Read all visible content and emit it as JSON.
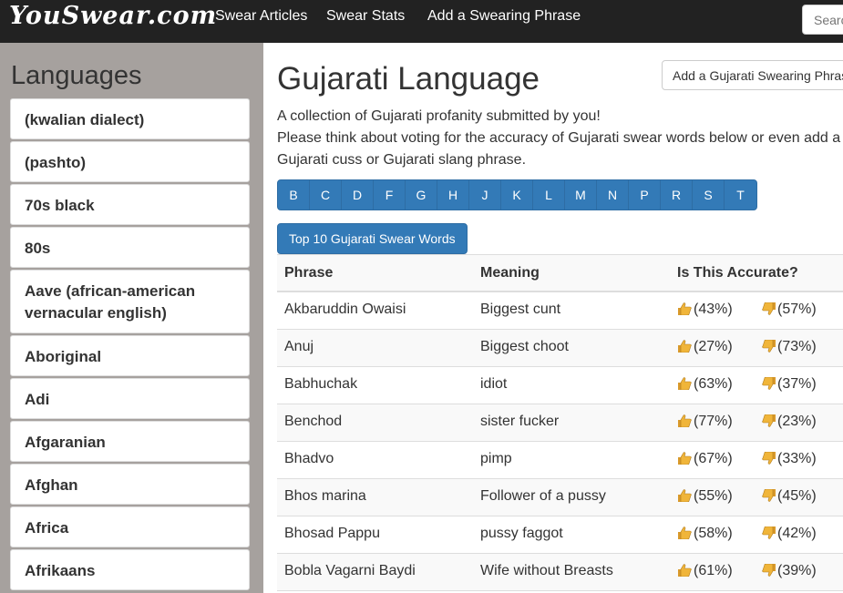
{
  "navbar": {
    "logo": "YouSwear.com",
    "links": [
      "Swear Articles",
      "Swear Stats",
      "Add a Swearing Phrase"
    ],
    "search_placeholder": "Search"
  },
  "sidebar": {
    "title": "Languages",
    "items": [
      "(kwalian dialect)",
      "(pashto)",
      "70s black",
      "80s",
      "Aave (african-american vernacular english)",
      "Aboriginal",
      "Adi",
      "Afgaranian",
      "Afghan",
      "Africa",
      "Afrikaans"
    ]
  },
  "main": {
    "title": "Gujarati Language",
    "add_button": "Add a Gujarati Swearing Phrase",
    "intro_line1": "A collection of Gujarati profanity submitted by you!",
    "intro_line2": "Please think about voting for the accuracy of Gujarati swear words below or even add a Gujarati cuss or Gujarati slang phrase.",
    "letters": [
      "B",
      "C",
      "D",
      "F",
      "G",
      "H",
      "J",
      "K",
      "L",
      "M",
      "N",
      "P",
      "R",
      "S",
      "T"
    ],
    "top10_button": "Top 10 Gujarati Swear Words",
    "table": {
      "headers": [
        "Phrase",
        "Meaning",
        "Is This Accurate?"
      ],
      "rows": [
        {
          "phrase": "Akbaruddin Owaisi",
          "meaning": "Biggest cunt",
          "up": "(43%)",
          "down": "(57%)"
        },
        {
          "phrase": "Anuj",
          "meaning": "Biggest choot",
          "up": "(27%)",
          "down": "(73%)"
        },
        {
          "phrase": "Babhuchak",
          "meaning": "idiot",
          "up": "(63%)",
          "down": "(37%)"
        },
        {
          "phrase": "Benchod",
          "meaning": "sister fucker",
          "up": "(77%)",
          "down": "(23%)"
        },
        {
          "phrase": "Bhadvo",
          "meaning": "pimp",
          "up": "(67%)",
          "down": "(33%)"
        },
        {
          "phrase": "Bhos marina",
          "meaning": "Follower of a pussy",
          "up": "(55%)",
          "down": "(45%)"
        },
        {
          "phrase": "Bhosad Pappu",
          "meaning": "pussy faggot",
          "up": "(58%)",
          "down": "(42%)"
        },
        {
          "phrase": "Bobla Vagarni Baydi",
          "meaning": "Wife without Breasts",
          "up": "(61%)",
          "down": "(39%)"
        }
      ]
    }
  },
  "colors": {
    "navbar": "#222222",
    "sidebar": "#a6a19e",
    "primary": "#337ab7",
    "thumb": "#f0b53a"
  }
}
